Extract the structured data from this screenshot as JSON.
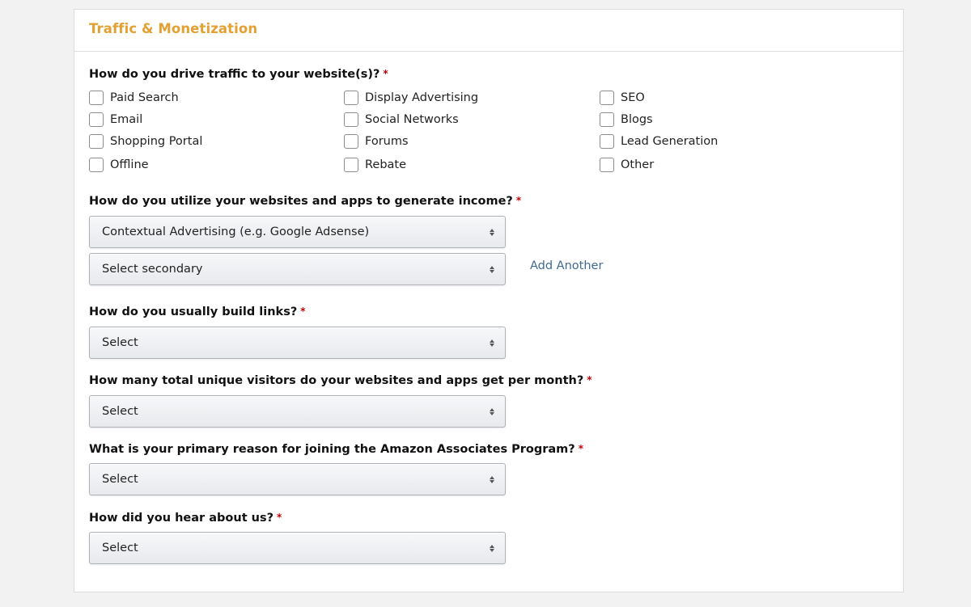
{
  "section": {
    "title": "Traffic & Monetization"
  },
  "required_marker": "*",
  "traffic": {
    "label": "How do you drive traffic to your website(s)?",
    "options": [
      {
        "label": "Paid Search",
        "checked": false
      },
      {
        "label": "Email",
        "checked": false
      },
      {
        "label": "Shopping Portal",
        "checked": false
      },
      {
        "label": "Offline",
        "checked": false
      },
      {
        "label": "Display Advertising",
        "checked": false
      },
      {
        "label": "Social Networks",
        "checked": false
      },
      {
        "label": "Forums",
        "checked": false
      },
      {
        "label": "Rebate",
        "checked": false
      },
      {
        "label": "SEO",
        "checked": false
      },
      {
        "label": "Blogs",
        "checked": false
      },
      {
        "label": "Lead Generation",
        "checked": false
      },
      {
        "label": "Other",
        "checked": false
      }
    ]
  },
  "income": {
    "label": "How do you utilize your websites and apps to generate income?",
    "primary_value": "Contextual Advertising (e.g. Google Adsense)",
    "secondary_value": "Select secondary",
    "add_another_label": "Add Another"
  },
  "links": {
    "label": "How do you usually build links?",
    "value": "Select"
  },
  "visitors": {
    "label": "How many total unique visitors do your websites and apps get per month?",
    "value": "Select"
  },
  "reason": {
    "label": "What is your primary reason for joining the Amazon Associates Program?",
    "value": "Select"
  },
  "hear": {
    "label": "How did you hear about us?",
    "value": "Select"
  }
}
